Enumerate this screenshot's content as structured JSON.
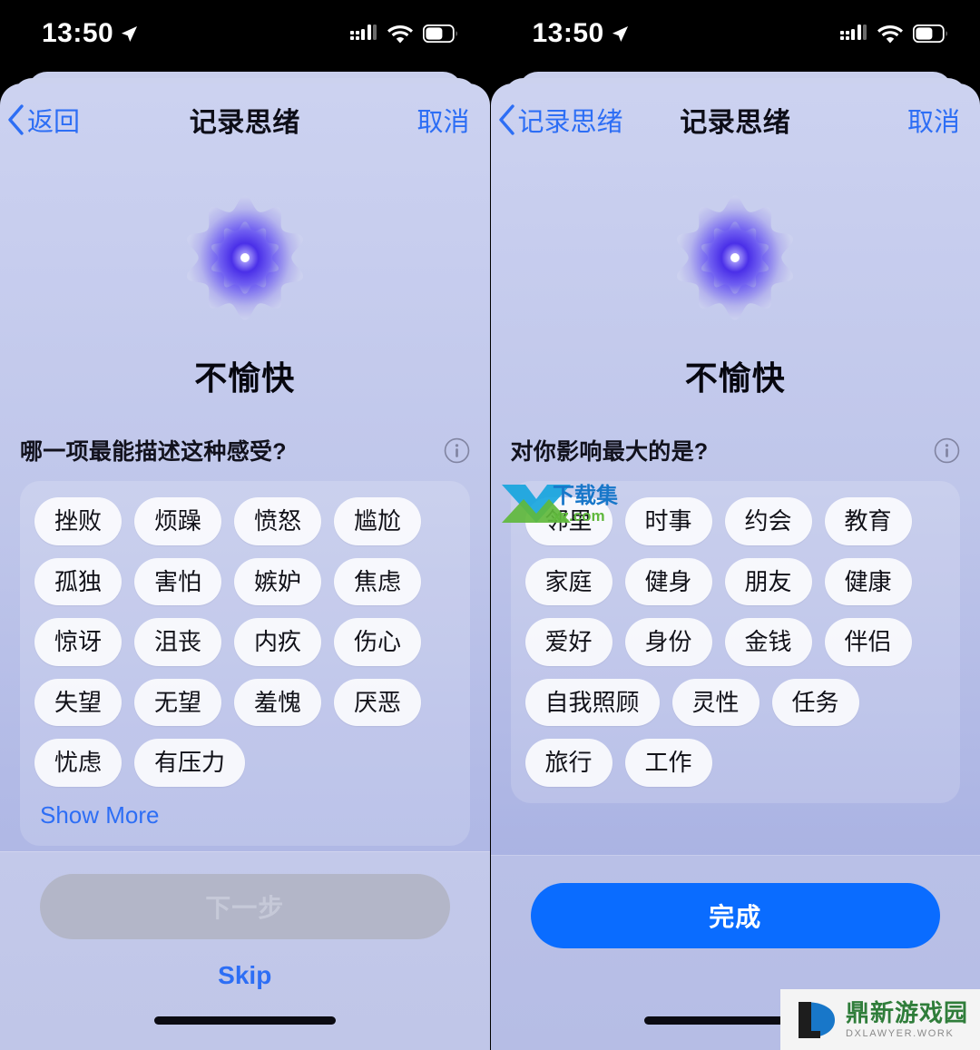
{
  "status_bar": {
    "time": "13:50",
    "location_icon": "location-arrow-icon",
    "cellular_icon": "cellular-signal-icon",
    "wifi_icon": "wifi-icon",
    "battery_icon": "battery-icon"
  },
  "colors": {
    "accent_blue": "#2d6ef5",
    "cta_blue": "#0a6cff",
    "sheet_top": "#ccd2f0",
    "sheet_bottom": "#a9b2e2",
    "tag_bg": "#ffffff",
    "disabled_button": "#b3b6c8",
    "text_primary": "#0d0d17"
  },
  "left_screen": {
    "nav": {
      "back_label": "返回",
      "title": "记录思绪",
      "cancel_label": "取消"
    },
    "hero": {
      "icon_name": "bloom-star-icon",
      "mood_label": "不愉快"
    },
    "question": {
      "text": "哪一项最能描述这种感受?",
      "info_icon": "info-circle-icon"
    },
    "tags": [
      "挫败",
      "烦躁",
      "愤怒",
      "尴尬",
      "孤独",
      "害怕",
      "嫉妒",
      "焦虑",
      "惊讶",
      "沮丧",
      "内疚",
      "伤心",
      "失望",
      "无望",
      "羞愧",
      "厌恶",
      "忧虑",
      "有压力"
    ],
    "show_more_label": "Show More",
    "footer": {
      "primary_label": "下一步",
      "primary_disabled": true,
      "skip_label": "Skip"
    }
  },
  "right_screen": {
    "nav": {
      "back_label": "记录思绪",
      "title": "记录思绪",
      "cancel_label": "取消"
    },
    "hero": {
      "icon_name": "bloom-star-icon",
      "mood_label": "不愉快"
    },
    "question": {
      "text": "对你影响最大的是?",
      "info_icon": "info-circle-icon"
    },
    "tags": [
      "邻里",
      "时事",
      "约会",
      "教育",
      "家庭",
      "健身",
      "朋友",
      "健康",
      "爱好",
      "身份",
      "金钱",
      "伴侣",
      "自我照顾",
      "灵性",
      "任务",
      "旅行",
      "工作"
    ],
    "footer": {
      "primary_label": "完成",
      "primary_disabled": false
    }
  },
  "watermarks": {
    "center": {
      "text_main": "下载集",
      "text_sub": "xz.com"
    },
    "corner": {
      "text_main": "鼎新游戏园",
      "text_sub": "DXLAWYER.WORK"
    }
  }
}
